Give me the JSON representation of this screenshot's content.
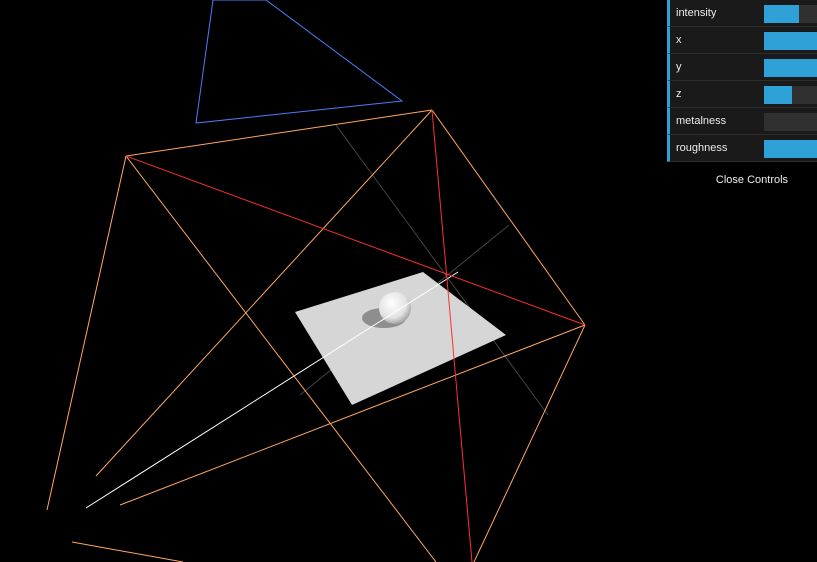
{
  "gui": {
    "controls": [
      {
        "label": "intensity",
        "fraction": 0.5
      },
      {
        "label": "x",
        "fraction": 1.0
      },
      {
        "label": "y",
        "fraction": 1.0
      },
      {
        "label": "z",
        "fraction": 0.4
      },
      {
        "label": "metalness",
        "fraction": 0.0
      },
      {
        "label": "roughness",
        "fraction": 1.0
      }
    ],
    "close_label": "Close Controls",
    "accent_color": "#2fa1d6"
  },
  "scene": {
    "background": "#000000",
    "objects": [
      "shadow-camera-frustum-helper",
      "light-helper",
      "ground-plane",
      "sphere"
    ]
  }
}
